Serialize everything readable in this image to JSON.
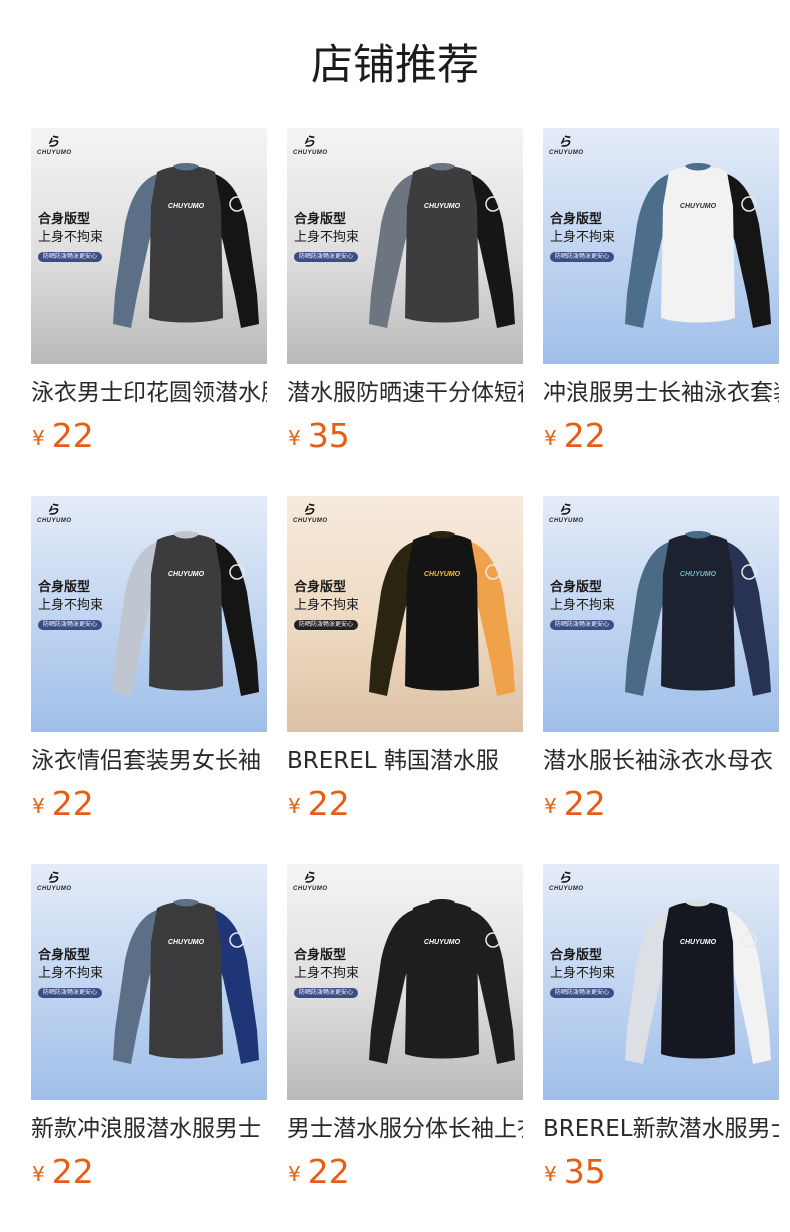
{
  "header": {
    "title": "店铺推荐"
  },
  "promo": {
    "line1": "合身版型",
    "line2": "上身不拘束",
    "pill": "防晒防泼畅泳更安心",
    "brand": "CHUYUMO",
    "brand_mark": "ら"
  },
  "products": [
    {
      "name": "泳衣男士印花圆领潜水服",
      "currency": "¥",
      "price": "22",
      "bg": "gray",
      "body": "#3b3b3d",
      "sleeve_left": "#5b6f86",
      "sleeve_right": "#151515",
      "chest": "#ffffff"
    },
    {
      "name": "潜水服防晒速干分体短袖",
      "currency": "¥",
      "price": "35",
      "bg": "gray",
      "body": "#3d3d3f",
      "sleeve_left": "#6c7580",
      "sleeve_right": "#161616",
      "chest": "#ffffff"
    },
    {
      "name": "冲浪服男士长袖泳衣套装",
      "currency": "¥",
      "price": "22",
      "bg": "blue",
      "body": "#f2f2f2",
      "sleeve_left": "#4c6d8c",
      "sleeve_right": "#151515",
      "chest": "#333333"
    },
    {
      "name": "泳衣情侣套装男女长袖",
      "currency": "¥",
      "price": "22",
      "bg": "blue",
      "body": "#3c3c3e",
      "sleeve_left": "#bfc6cf",
      "sleeve_right": "#151515",
      "chest": "#ffffff"
    },
    {
      "name": "BREREL 韩国潜水服",
      "currency": "¥",
      "price": "22",
      "bg": "beige",
      "body": "#141414",
      "sleeve_left": "#2a2410",
      "sleeve_right": "#f0a24a",
      "chest": "#f3c21f"
    },
    {
      "name": "潜水服长袖泳衣水母衣",
      "currency": "¥",
      "price": "22",
      "bg": "blue",
      "body": "#1c2230",
      "sleeve_left": "#4a6a86",
      "sleeve_right": "#283252",
      "chest": "#7ab3c2"
    },
    {
      "name": "新款冲浪服潜水服男士",
      "currency": "¥",
      "price": "22",
      "bg": "blue",
      "body": "#3b3b3d",
      "sleeve_left": "#5b6f86",
      "sleeve_right": "#1f3577",
      "chest": "#ffffff"
    },
    {
      "name": "男士潜水服分体长袖上衣",
      "currency": "¥",
      "price": "22",
      "bg": "gray",
      "body": "#1e1e1f",
      "sleeve_left": "#1e1e1f",
      "sleeve_right": "#1e1e1f",
      "chest": "#ffffff"
    },
    {
      "name": "BREREL新款潜水服男士",
      "currency": "¥",
      "price": "35",
      "bg": "blue",
      "body": "#151821",
      "sleeve_left": "#dcdfe4",
      "sleeve_right": "#f2f2f2",
      "chest": "#ffffff"
    }
  ]
}
